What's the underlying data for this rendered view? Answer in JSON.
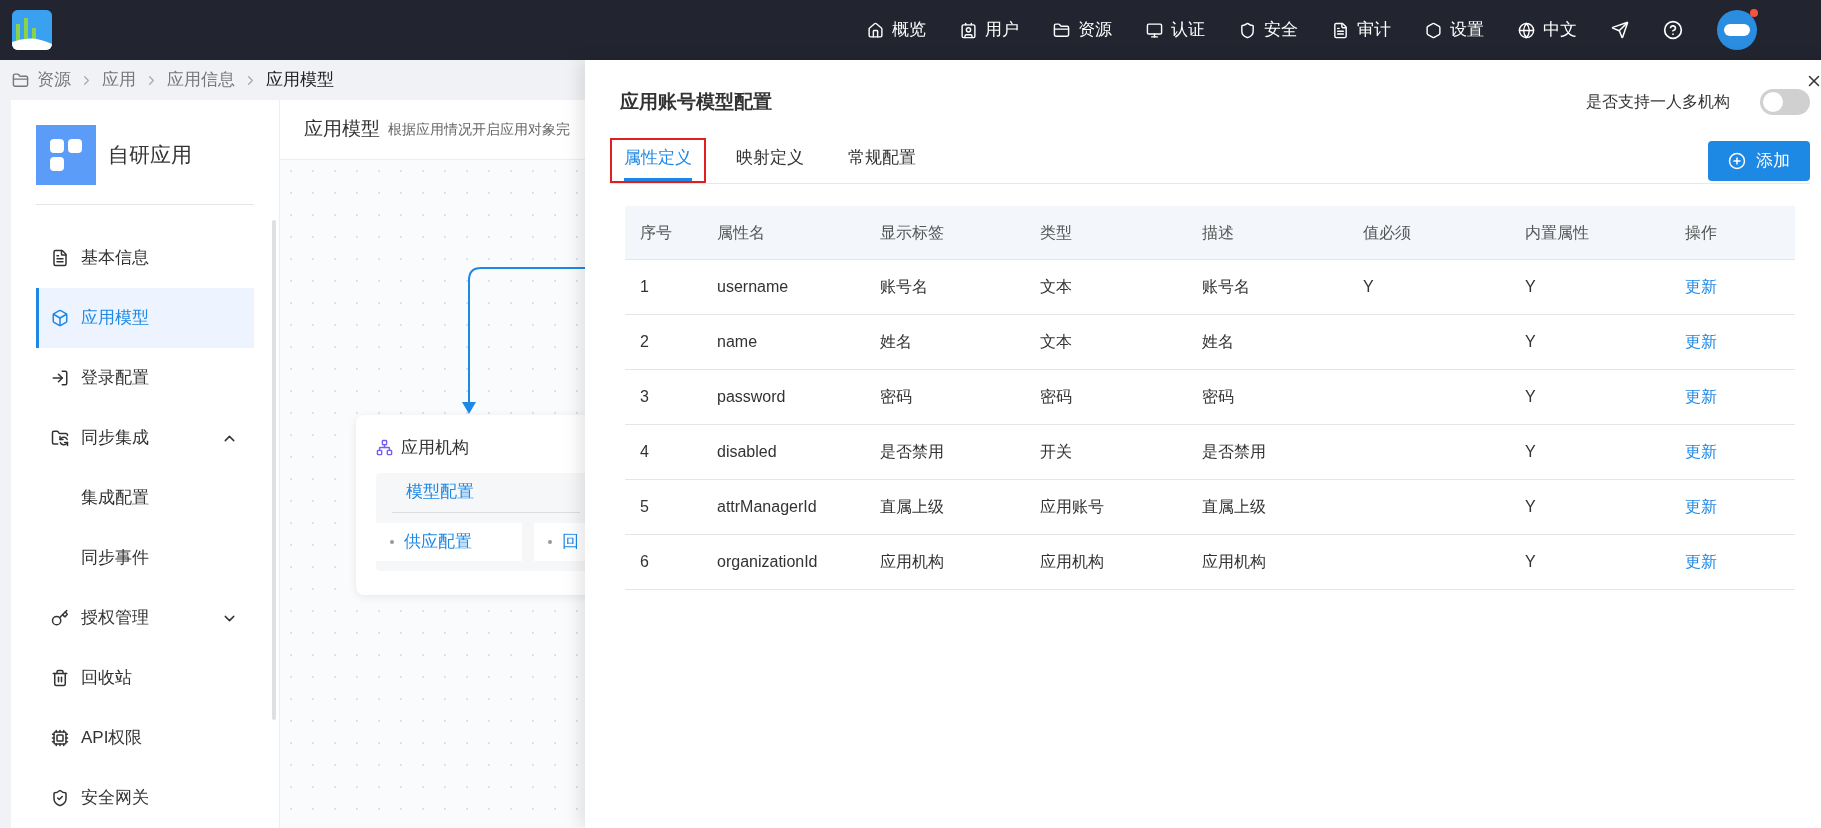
{
  "header": {
    "nav": [
      {
        "label": "概览"
      },
      {
        "label": "用户"
      },
      {
        "label": "资源"
      },
      {
        "label": "认证"
      },
      {
        "label": "安全"
      },
      {
        "label": "审计"
      },
      {
        "label": "设置"
      },
      {
        "label": "中文"
      }
    ],
    "avatar_badge": true
  },
  "breadcrumb": [
    "资源",
    "应用",
    "应用信息",
    "应用模型"
  ],
  "sidebar": {
    "app_name": "自研应用",
    "items": [
      {
        "label": "基本信息",
        "selected": false
      },
      {
        "label": "应用模型",
        "selected": true
      },
      {
        "label": "登录配置",
        "selected": false
      },
      {
        "label": "同步集成",
        "selected": false,
        "expanded": true,
        "children": [
          {
            "label": "集成配置",
            "selected": false
          },
          {
            "label": "同步事件",
            "selected": false
          }
        ]
      },
      {
        "label": "授权管理",
        "selected": false,
        "expanded": false
      },
      {
        "label": "回收站",
        "selected": false
      },
      {
        "label": "API权限",
        "selected": false
      },
      {
        "label": "安全网关",
        "selected": false
      }
    ]
  },
  "content": {
    "title": "应用模型",
    "subtitle": "根据应用情况开启应用对象完",
    "node": {
      "title": "应用机构",
      "tab": "模型配置",
      "items": [
        "供应配置",
        "回"
      ]
    }
  },
  "drawer": {
    "title": "应用账号模型配置",
    "toggle": {
      "label": "是否支持一人多机构",
      "on": false
    },
    "tabs": [
      {
        "label": "属性定义",
        "selected": true,
        "highlighted": true
      },
      {
        "label": "映射定义",
        "selected": false,
        "highlighted": false
      },
      {
        "label": "常规配置",
        "selected": false,
        "highlighted": false
      }
    ],
    "add_button": "添加",
    "table": {
      "columns": [
        "序号",
        "属性名",
        "显示标签",
        "类型",
        "描述",
        "值必须",
        "内置属性",
        "操作"
      ],
      "rows": [
        {
          "cells": [
            "1",
            "username",
            "账号名",
            "文本",
            "账号名",
            "Y",
            "Y"
          ],
          "action": "更新"
        },
        {
          "cells": [
            "2",
            "name",
            "姓名",
            "文本",
            "姓名",
            "",
            "Y"
          ],
          "action": "更新"
        },
        {
          "cells": [
            "3",
            "password",
            "密码",
            "密码",
            "密码",
            "",
            "Y"
          ],
          "action": "更新"
        },
        {
          "cells": [
            "4",
            "disabled",
            "是否禁用",
            "开关",
            "是否禁用",
            "",
            "Y"
          ],
          "action": "更新"
        },
        {
          "cells": [
            "5",
            "attrManagerId",
            "直属上级",
            "应用账号",
            "直属上级",
            "",
            "Y"
          ],
          "action": "更新"
        },
        {
          "cells": [
            "6",
            "organizationId",
            "应用机构",
            "应用机构",
            "应用机构",
            "",
            "Y"
          ],
          "action": "更新"
        }
      ]
    }
  }
}
